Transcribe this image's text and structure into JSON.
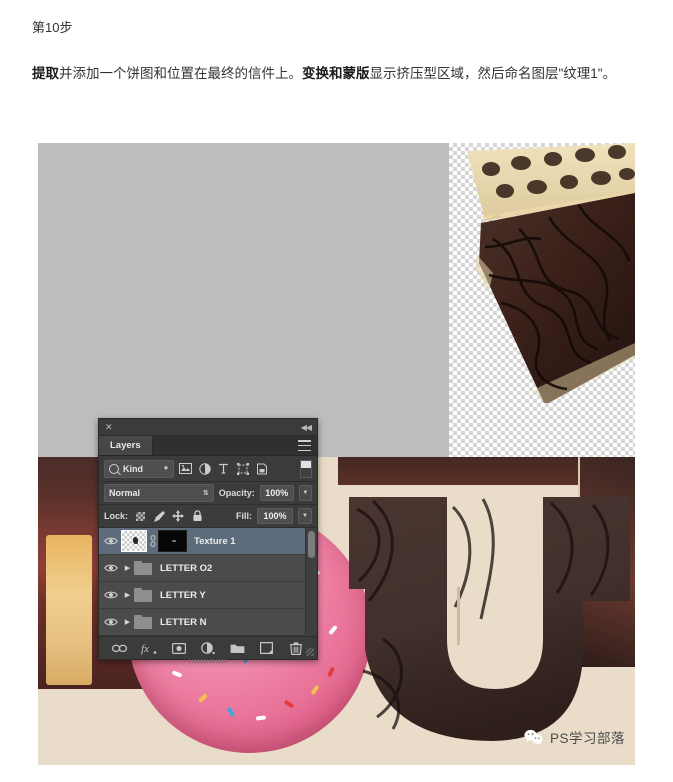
{
  "article": {
    "step_label": "第10步",
    "paragraph_parts": [
      {
        "text": "提取",
        "bold": true
      },
      {
        "text": "并添加一个饼图和位置在最终的信件上。",
        "bold": false
      },
      {
        "text": "变换和蒙版",
        "bold": true
      },
      {
        "text": "显示挤压型区域，然后命名图层\"纹理1\"。",
        "bold": false
      }
    ]
  },
  "photoshop_panel": {
    "title_close": "✕",
    "collapse_icon": "◀◀",
    "tab_label": "Layers",
    "menu_icon": "panel-menu-icon",
    "filter_row": {
      "search_icon": "search-icon",
      "kind_label": "Kind",
      "stepper_up": "▲",
      "stepper_down": "▼",
      "filters": [
        {
          "name": "filter-pixel-layers",
          "glyph": "🖼"
        },
        {
          "name": "filter-adjustment-layers",
          "glyph": "◐"
        },
        {
          "name": "filter-type-layers",
          "glyph": "T"
        },
        {
          "name": "filter-shape-layers",
          "glyph": "⬚"
        },
        {
          "name": "filter-smart-objects",
          "glyph": "⬓"
        }
      ],
      "toggle_name": "filter-enable-toggle"
    },
    "blend_row": {
      "blend_mode": "Normal",
      "blend_stepper": "⇅",
      "opacity_label": "Opacity:",
      "opacity_value": "100%",
      "opacity_arrow": "▼"
    },
    "lock_row": {
      "lock_label": "Lock:",
      "lock_icons": [
        {
          "name": "lock-transparent-pixels-icon",
          "glyph": ""
        },
        {
          "name": "lock-image-pixels-icon",
          "glyph": "✒"
        },
        {
          "name": "lock-position-icon",
          "glyph": "✥"
        },
        {
          "name": "lock-all-icon",
          "glyph": "🔒"
        }
      ],
      "fill_label": "Fill:",
      "fill_value": "100%",
      "fill_arrow": "▼"
    },
    "layers": [
      {
        "name": "Texture 1",
        "type": "image",
        "selected": true,
        "visible": true,
        "eye_icon": "👁",
        "has_mask": true,
        "link_icon": "🔗"
      },
      {
        "name": "LETTER O2",
        "type": "group",
        "selected": false,
        "visible": true,
        "eye_icon": "👁",
        "arrow": "▶"
      },
      {
        "name": "LETTER Y",
        "type": "group",
        "selected": false,
        "visible": true,
        "eye_icon": "👁",
        "arrow": "▶"
      },
      {
        "name": "LETTER N",
        "type": "group",
        "selected": false,
        "visible": true,
        "eye_icon": "👁",
        "arrow": "▶"
      }
    ],
    "footer_buttons": [
      {
        "name": "link-layers-button",
        "glyph": "⛓"
      },
      {
        "name": "layer-style-fx-button",
        "glyph": "fx"
      },
      {
        "name": "add-layer-mask-button",
        "glyph": "▣"
      },
      {
        "name": "new-adjustment-layer-button",
        "glyph": "◑"
      },
      {
        "name": "new-group-button",
        "glyph": "🗀"
      },
      {
        "name": "new-layer-button",
        "glyph": "⧉"
      },
      {
        "name": "delete-layer-button",
        "glyph": "🗑"
      }
    ]
  },
  "canvas": {
    "background_color": "#bdbdbd",
    "checker_region_label": "transparency-checkerboard",
    "pie_slice_label": "chocolate-pie-slice",
    "photo_background_color": "#e9dcc8",
    "donut_label": "pink-sprinkle-donut",
    "letter_label": "chocolate-letter-u",
    "letter_u_color": "#43302c"
  },
  "watermark": {
    "icon_name": "wechat-icon",
    "text": "PS学习部落"
  }
}
